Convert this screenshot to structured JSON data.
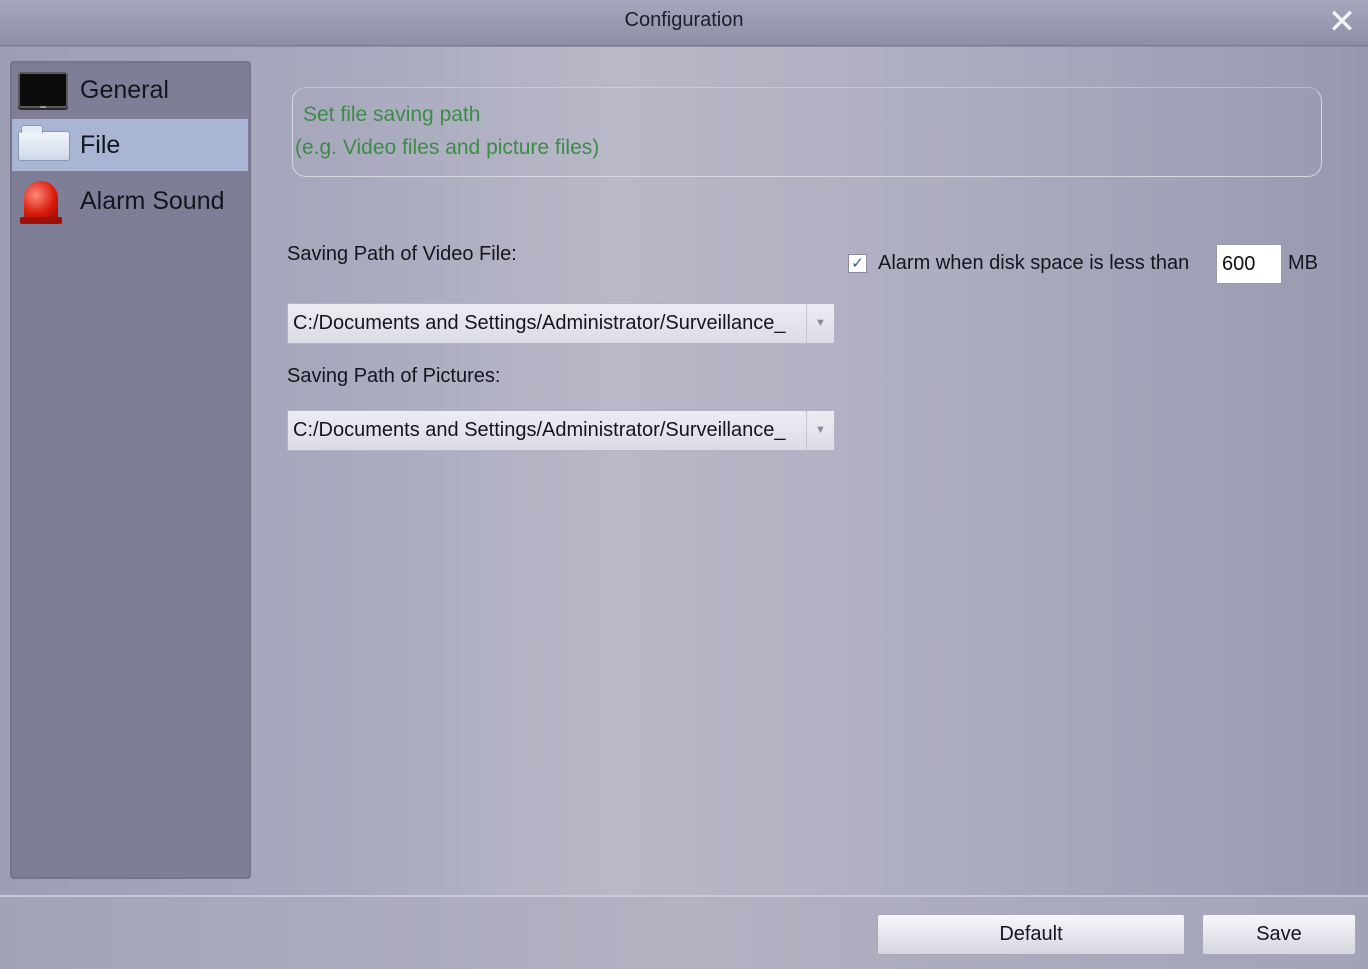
{
  "window": {
    "title": "Configuration",
    "close_icon": "close-icon"
  },
  "sidebar": {
    "items": [
      {
        "label": "General",
        "icon": "monitor-icon",
        "active": false
      },
      {
        "label": "File",
        "icon": "folder-icon",
        "active": true
      },
      {
        "label": "Alarm Sound",
        "icon": "siren-icon",
        "active": false
      }
    ]
  },
  "hint": {
    "line1": "Set file saving path",
    "line2": "(e.g. Video files and picture files)",
    "color": "#3c8c48"
  },
  "video_path": {
    "label": "Saving Path of Video File:",
    "value": "C:/Documents and Settings/Administrator/Surveillance_"
  },
  "picture_path": {
    "label": "Saving Path of Pictures:",
    "value": "C:/Documents and Settings/Administrator/Surveillance_"
  },
  "disk_alarm": {
    "checked": true,
    "label": "Alarm when disk space is less than",
    "value": "600",
    "unit": "MB"
  },
  "footer": {
    "default_label": "Default",
    "save_label": "Save"
  },
  "colors": {
    "active_nav": "#a8b6d4",
    "sidebar_bg": "#7e7e96"
  }
}
